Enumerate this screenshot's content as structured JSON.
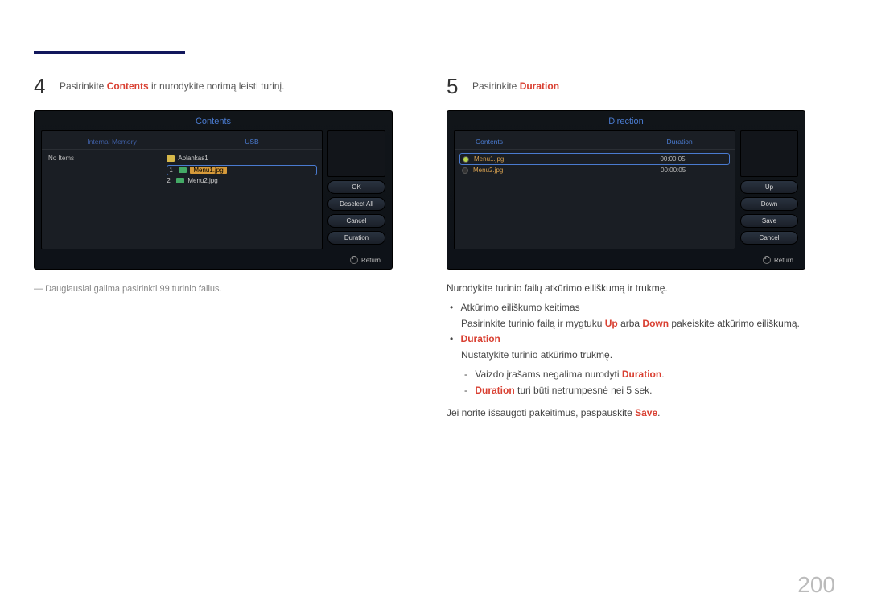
{
  "page_number": "200",
  "step4": {
    "num": "4",
    "text_before": "Pasirinkite ",
    "text_hl": "Contents",
    "text_after": " ir nurodykite norimą leisti turinį.",
    "note": "Daugiausiai galima pasirinkti 99 turinio failus.",
    "screen": {
      "title": "Contents",
      "tab_left": "Internal Memory",
      "tab_right": "USB",
      "no_items": "No Items",
      "folder": "Aplankas1",
      "file1_num": "1",
      "file1_name": "Menu1.jpg",
      "file2_num": "2",
      "file2_name": "Menu2.jpg",
      "btn_ok": "OK",
      "btn_deselect": "Deselect All",
      "btn_cancel": "Cancel",
      "btn_duration": "Duration",
      "return": "Return"
    }
  },
  "step5": {
    "num": "5",
    "text_before": "Pasirinkite ",
    "text_hl": "Duration",
    "screen": {
      "title": "Direction",
      "col_contents": "Contents",
      "col_duration": "Duration",
      "row1_name": "Menu1.jpg",
      "row1_dur": "00:00:05",
      "row2_name": "Menu2.jpg",
      "row2_dur": "00:00:05",
      "btn_up": "Up",
      "btn_down": "Down",
      "btn_save": "Save",
      "btn_cancel": "Cancel",
      "return": "Return"
    },
    "intro": "Nurodykite turinio failų atkūrimo eiliškumą ir trukmę.",
    "li1_title": "Atkūrimo eiliškumo keitimas",
    "li1_before": "Pasirinkite turinio failą ir mygtuku ",
    "li1_up": "Up",
    "li1_mid": " arba ",
    "li1_down": "Down",
    "li1_after": " pakeiskite atkūrimo eiliškumą.",
    "li2_title": "Duration",
    "li2_text": "Nustatykite turinio atkūrimo trukmę.",
    "li2_sub1_before": "Vaizdo įrašams negalima nurodyti ",
    "li2_sub1_hl": "Duration",
    "li2_sub1_after": ".",
    "li2_sub2_hl": "Duration",
    "li2_sub2_after": " turi būti netrumpesnė nei 5 sek.",
    "save_before": "Jei norite išsaugoti pakeitimus, paspauskite ",
    "save_hl": "Save",
    "save_after": "."
  }
}
